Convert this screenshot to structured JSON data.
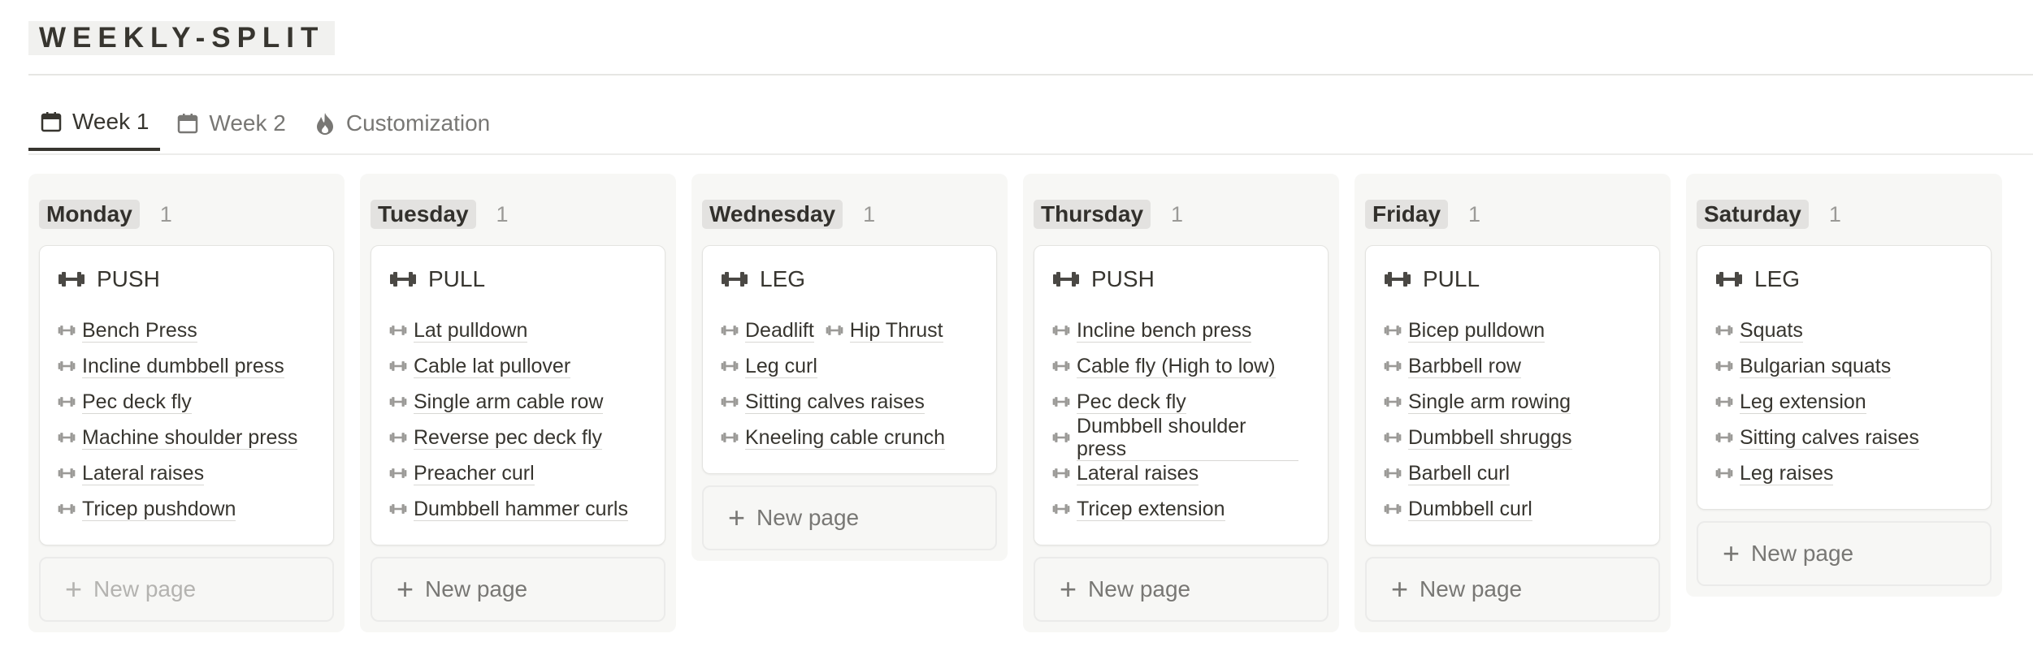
{
  "page": {
    "title": "WEEKLY-SPLIT"
  },
  "tabs": [
    {
      "label": "Week 1",
      "icon": "calendar-icon",
      "active": true
    },
    {
      "label": "Week 2",
      "icon": "calendar-icon",
      "active": false
    },
    {
      "label": "Customization",
      "icon": "flame-icon",
      "active": false
    }
  ],
  "new_page_label": "New page",
  "columns": [
    {
      "name": "Monday",
      "count": "1",
      "card": {
        "title": "PUSH",
        "items": [
          "Bench Press",
          "Incline dumbbell press",
          "Pec deck fly",
          "Machine shoulder press",
          "Lateral raises",
          "Tricep pushdown"
        ]
      }
    },
    {
      "name": "Tuesday",
      "count": "1",
      "card": {
        "title": "PULL",
        "items": [
          "Lat pulldown",
          "Cable lat pullover",
          "Single arm cable row",
          "Reverse pec deck fly",
          "Preacher curl",
          "Dumbbell hammer curls"
        ]
      }
    },
    {
      "name": "Wednesday",
      "count": "1",
      "card": {
        "title": "LEG",
        "items": [
          "Deadlift",
          "Hip Thrust",
          "Leg curl",
          "Sitting calves raises",
          "Kneeling cable crunch"
        ]
      }
    },
    {
      "name": "Thursday",
      "count": "1",
      "card": {
        "title": "PUSH",
        "items": [
          "Incline bench press",
          "Cable fly (High to low)",
          "Pec deck fly",
          "Dumbbell shoulder press",
          "Lateral raises",
          "Tricep extension"
        ]
      }
    },
    {
      "name": "Friday",
      "count": "1",
      "card": {
        "title": "PULL",
        "items": [
          "Bicep pulldown",
          "Barbbell row",
          "Single arm rowing",
          "Dumbbell shruggs",
          "Barbell curl",
          "Dumbbell curl"
        ]
      }
    },
    {
      "name": "Saturday",
      "count": "1",
      "card": {
        "title": "LEG",
        "items": [
          "Squats",
          "Bulgarian squats",
          "Leg extension",
          "Sitting calves raises",
          "Leg raises"
        ]
      }
    }
  ],
  "icons": {
    "card_icon": "dumbbell-icon",
    "item_icon": "dumbbell-icon",
    "new_page_icon": "plus-icon"
  },
  "colors": {
    "text": "#37352f",
    "muted": "#787774",
    "column_bg": "#f7f7f5",
    "tag_bg": "#e3e2e0"
  }
}
